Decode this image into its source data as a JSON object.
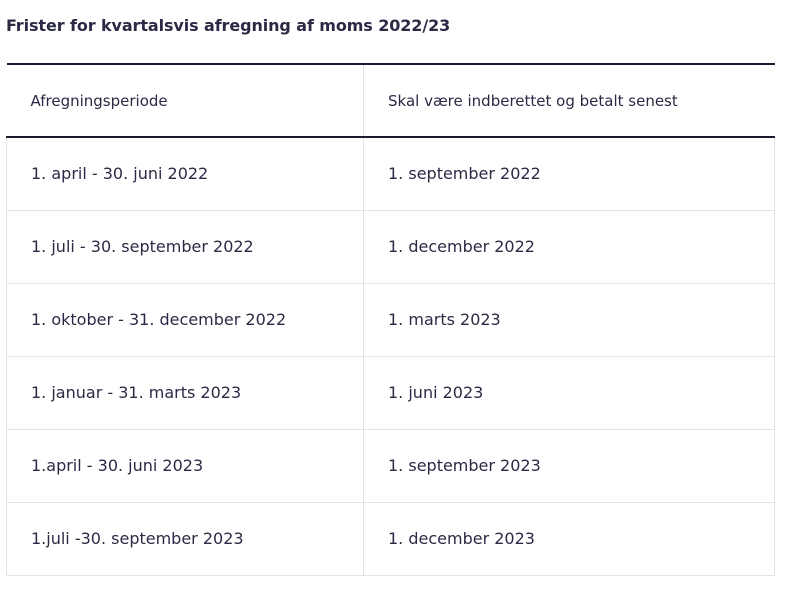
{
  "caption": "Frister for kvartalsvis afregning af moms 2022/23",
  "table": {
    "headers": [
      "Afregningsperiode",
      "Skal være indberettet og betalt senest"
    ],
    "rows": [
      [
        "1. april - 30. juni 2022",
        "1. september 2022"
      ],
      [
        "1. juli - 30. september 2022",
        "1. december 2022"
      ],
      [
        "1. oktober - 31. december 2022",
        "1. marts 2023"
      ],
      [
        "1. januar - 31. marts 2023",
        "1. juni 2023"
      ],
      [
        "1.april - 30. juni 2023",
        "1. september 2023"
      ],
      [
        "1.juli -30. september 2023",
        "1. december 2023"
      ]
    ]
  }
}
